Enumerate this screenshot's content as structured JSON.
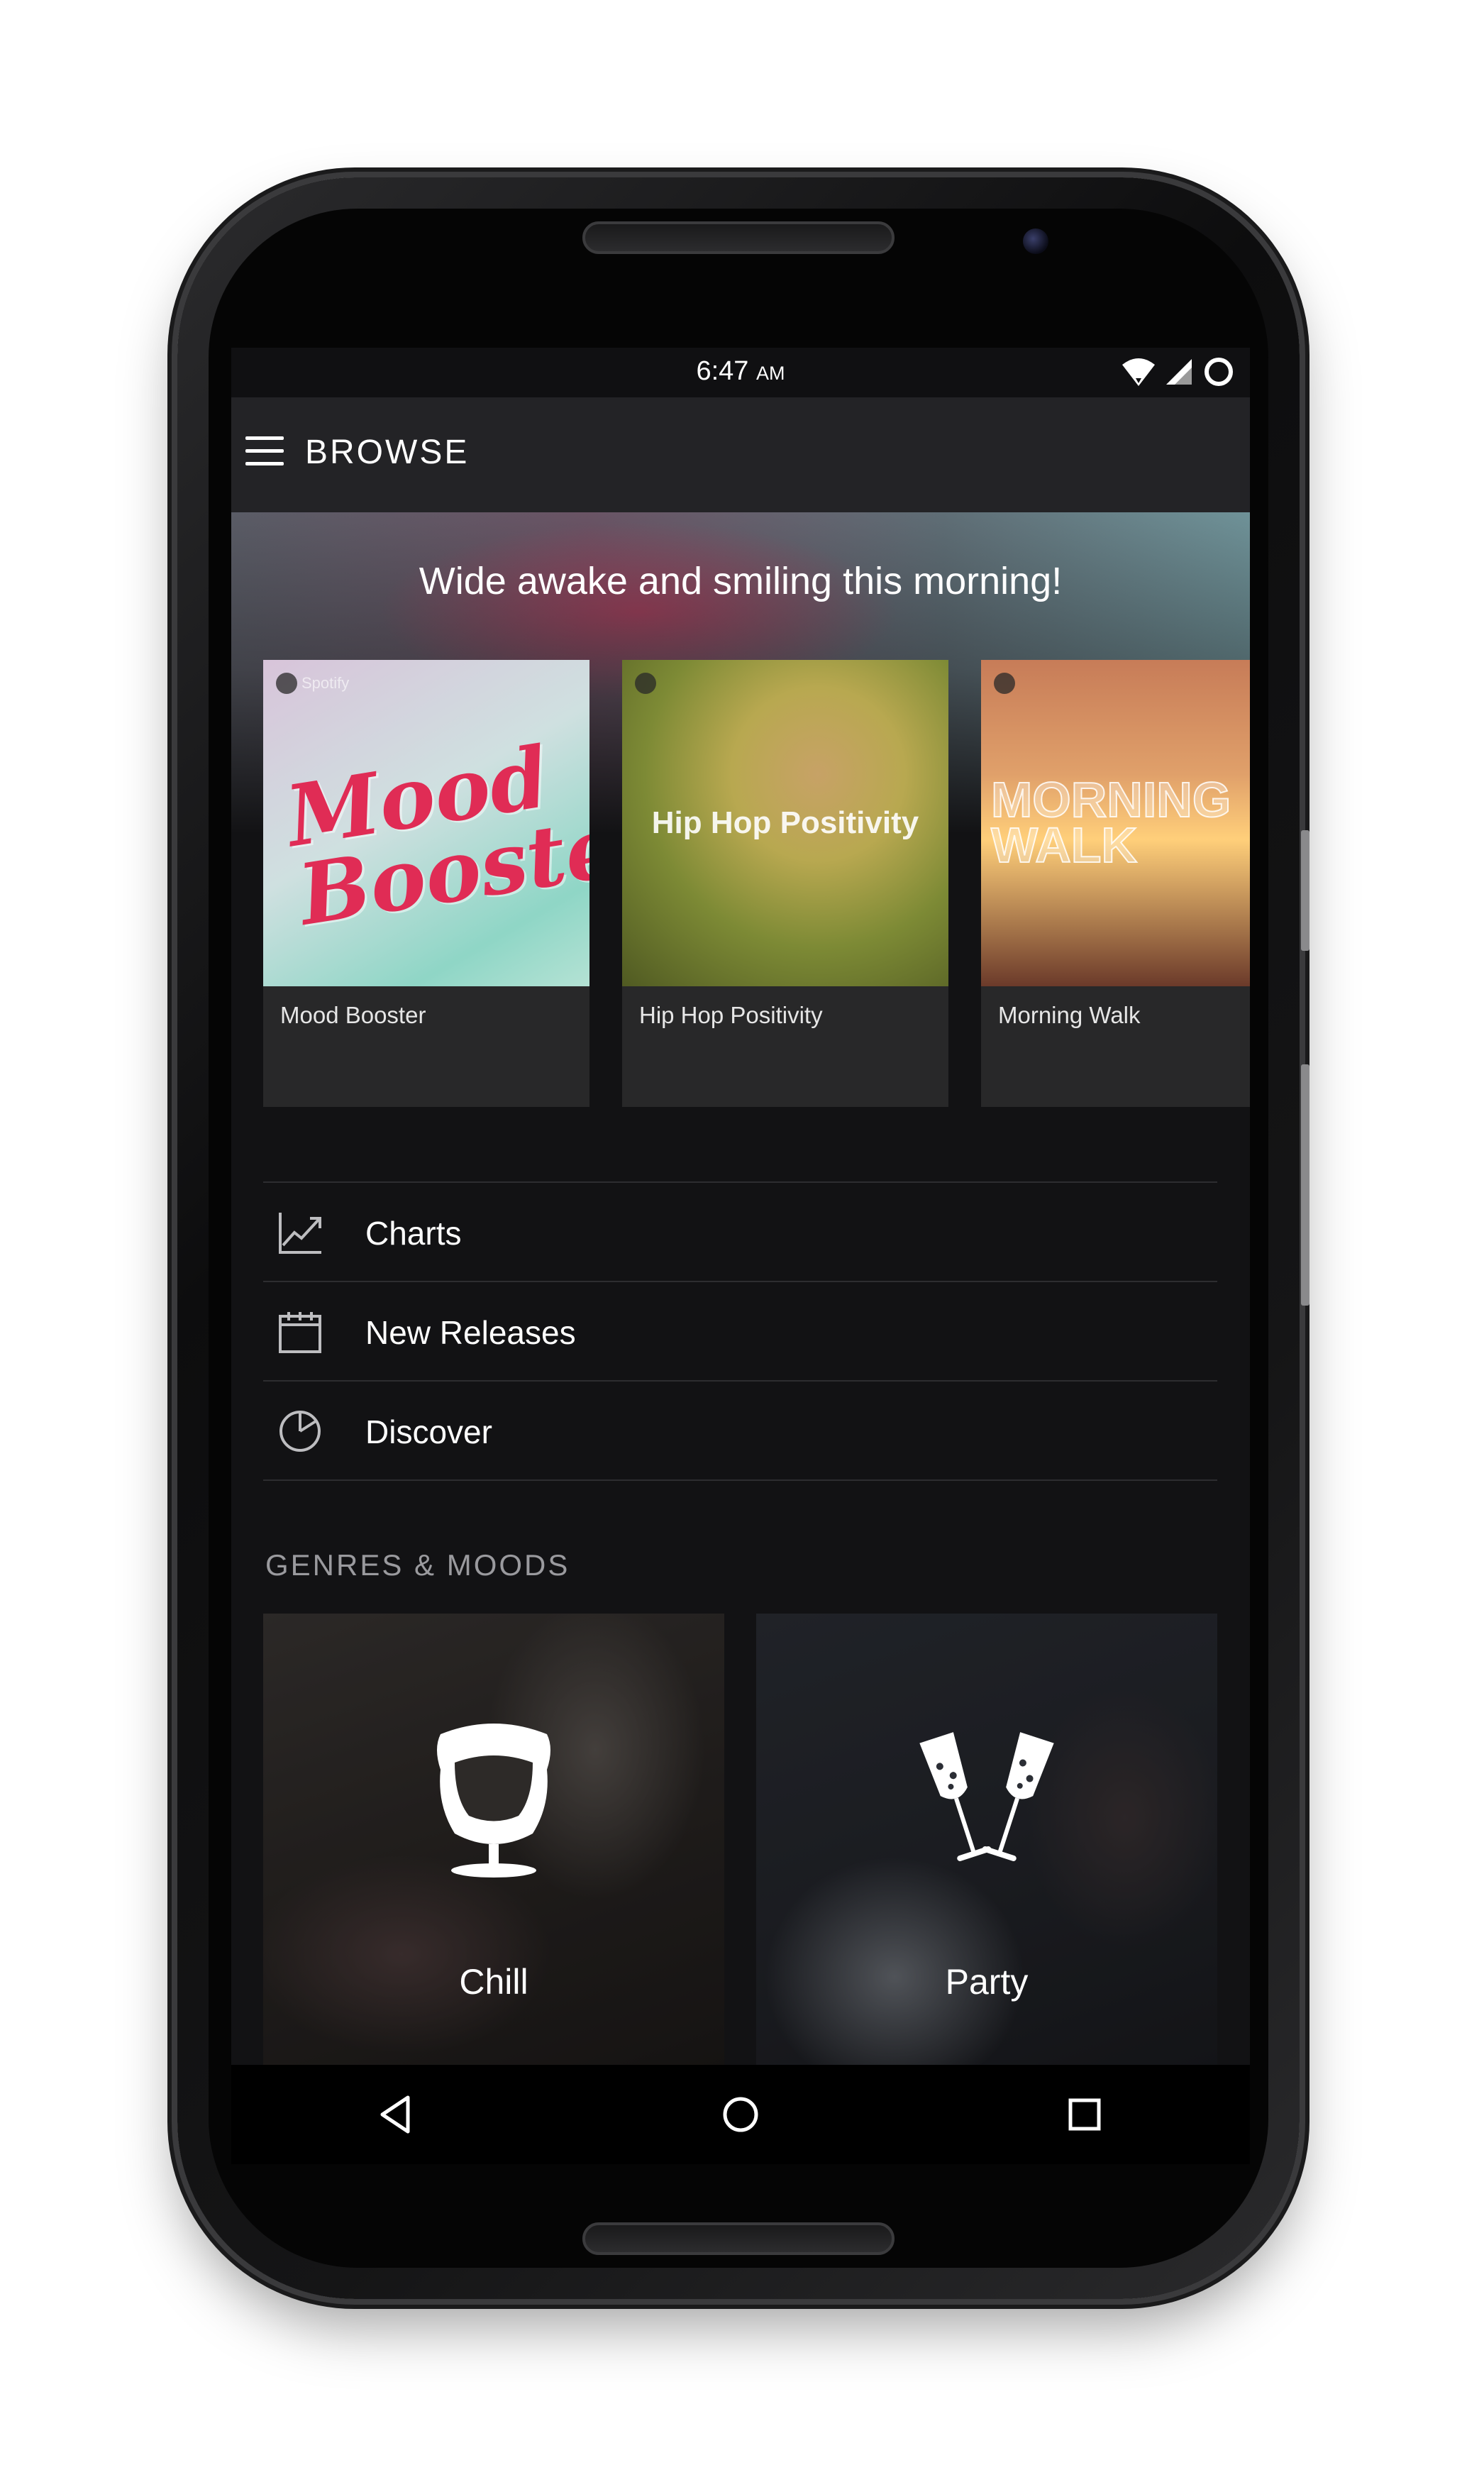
{
  "status_bar": {
    "time": "6:47",
    "ampm": "AM",
    "icons": [
      "wifi-icon",
      "signal-icon",
      "battery-icon"
    ]
  },
  "app_bar": {
    "title": "BROWSE",
    "menu_icon": "hamburger-menu-icon"
  },
  "featured": {
    "heading": "Wide awake and smiling this morning!",
    "playlists": [
      {
        "label": "Mood Booster",
        "art_text": "Mood Booster",
        "art_brand": "Spotify"
      },
      {
        "label": "Hip Hop Positivity",
        "art_text": "Hip Hop Positivity"
      },
      {
        "label": "Morning Walk",
        "art_text_line1": "MORNING",
        "art_text_line2": "WALK"
      }
    ]
  },
  "nav_list": [
    {
      "label": "Charts",
      "icon": "chart-line-icon"
    },
    {
      "label": "New Releases",
      "icon": "calendar-icon"
    },
    {
      "label": "Discover",
      "icon": "clock-pie-icon"
    }
  ],
  "genres": {
    "heading": "GENRES & MOODS",
    "tiles": [
      {
        "label": "Chill",
        "icon": "egg-chair-icon"
      },
      {
        "label": "Party",
        "icon": "champagne-glasses-icon"
      }
    ]
  },
  "system_nav": {
    "icons": [
      "back-icon",
      "home-icon",
      "recents-icon"
    ]
  },
  "colors": {
    "background": "#121214",
    "app_bar": "#232326",
    "card": "#282829",
    "divider": "#2d2d30",
    "section_heading": "#9a9a9e"
  }
}
